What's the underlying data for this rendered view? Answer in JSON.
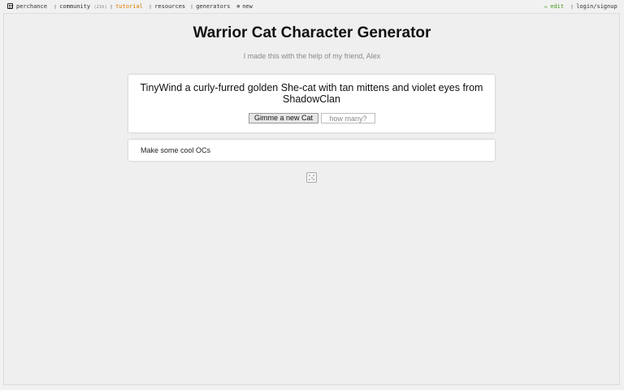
{
  "nav": {
    "logo_label": "perchance",
    "community_label": "community",
    "community_time": "(21h)",
    "tutorial_label": "tutorial",
    "resources_label": "resources",
    "generators_label": "generators",
    "new_label": "new",
    "edit_label": "edit",
    "login_label": "login/signup",
    "icons": [
      "die-icon",
      "chat-icon",
      "book-icon",
      "link-icon",
      "grid-icon",
      "plus-icon",
      "pencil-icon",
      "user-icon"
    ]
  },
  "page": {
    "title": "Warrior Cat Character Generator",
    "subtitle": "I made this with the help of my friend, Alex",
    "output_text": "TinyWind a curly-furred golden She-cat with tan mittens and violet eyes from ShadowClan",
    "generate_button": "Gimme a new Cat",
    "count_placeholder": "how many?",
    "note": "Make some cool OCs"
  },
  "colors": {
    "tutorial": "#e07b00",
    "edit": "#4a9a1a",
    "background": "#f1f1f1"
  }
}
